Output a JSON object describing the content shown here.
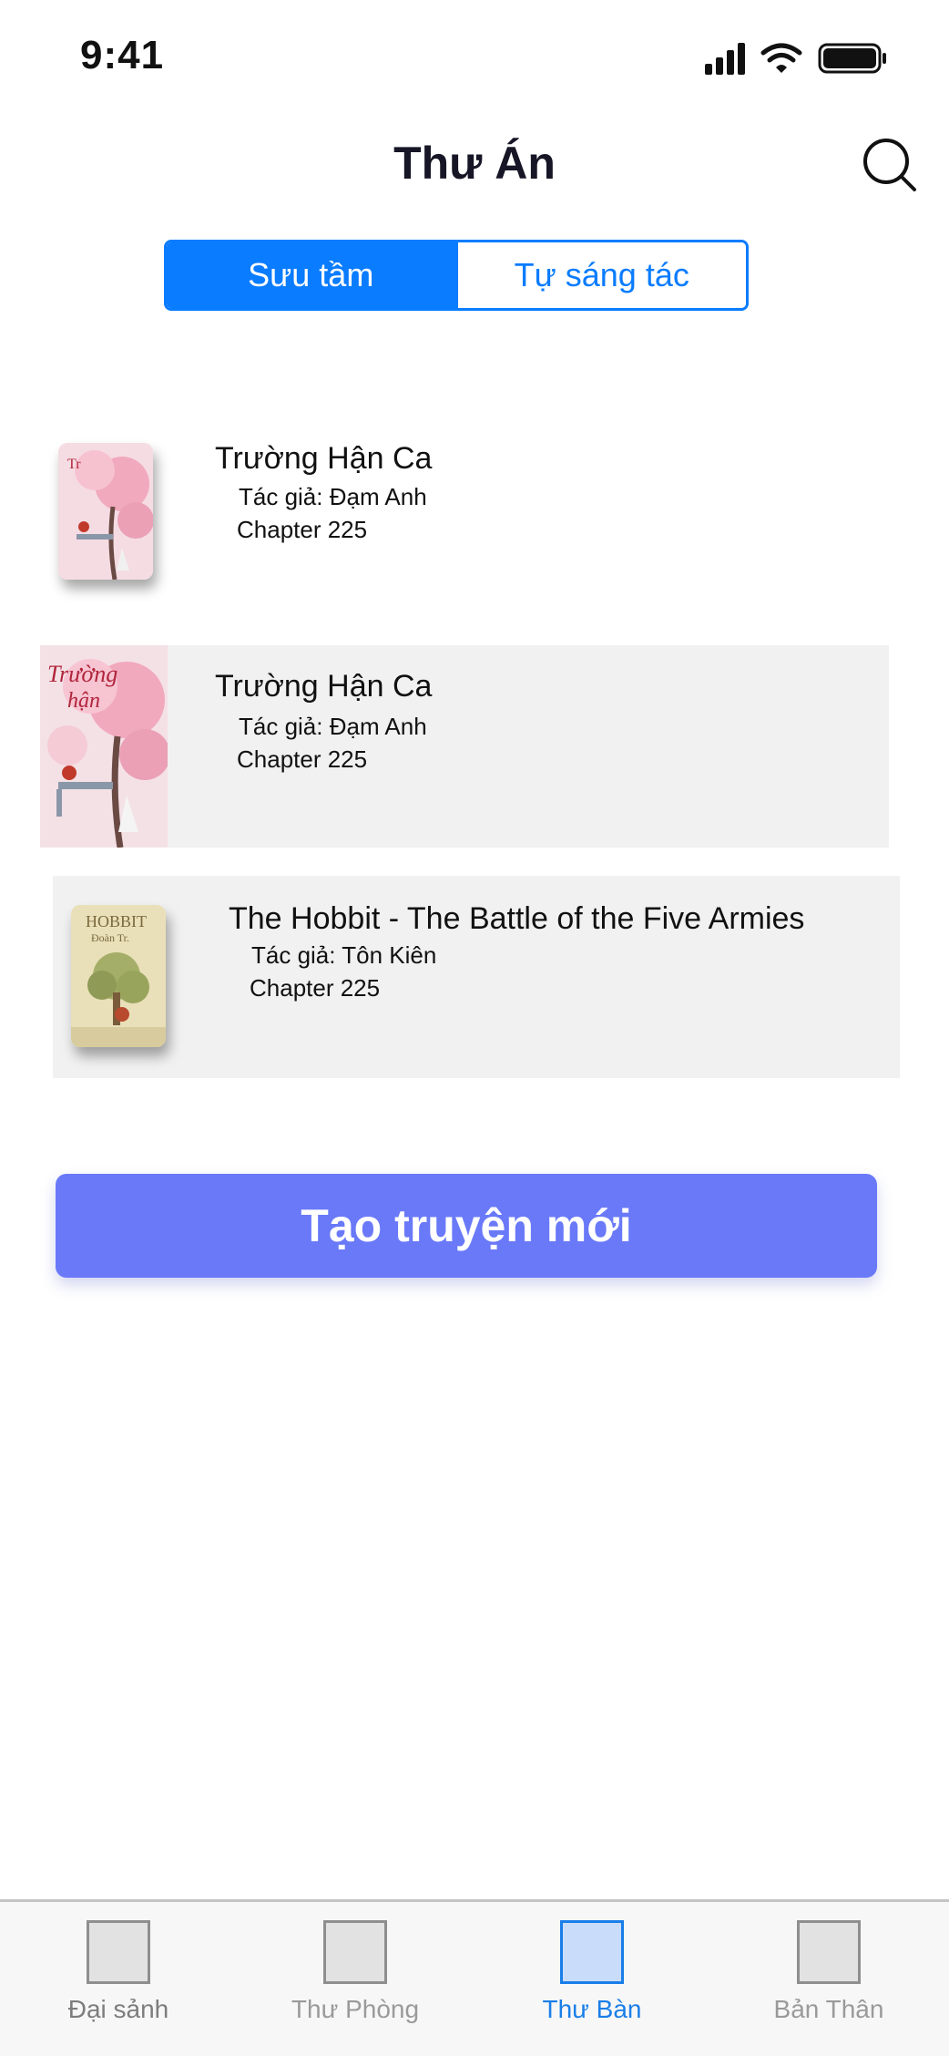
{
  "status_bar": {
    "time": "9:41"
  },
  "header": {
    "title": "Thư Án",
    "search_icon": "search-icon"
  },
  "segments": [
    {
      "label": "Sưu tầm",
      "active": true
    },
    {
      "label": "Tự sáng tác",
      "active": false
    }
  ],
  "books": [
    {
      "title": "Trường Hận Ca",
      "author": "Tác giả: Đạm Anh",
      "chapter": "Chapter 225"
    },
    {
      "title": "Trường Hận Ca",
      "author": "Tác giả: Đạm Anh",
      "chapter": "Chapter 225"
    },
    {
      "title": "The Hobbit - The Battle of the Five Armies",
      "author": "Tác giả: Tôn Kiên",
      "chapter": "Chapter 225"
    }
  ],
  "create_button": {
    "label": "Tạo truyện mới"
  },
  "tabbar": {
    "tabs": [
      {
        "label": "Đại sảnh",
        "active": false
      },
      {
        "label": "Thư Phòng",
        "active": false
      },
      {
        "label": "Thư Bàn",
        "active": true
      },
      {
        "label": "Bản Thân",
        "active": false
      }
    ]
  },
  "colors": {
    "accent": "#0a7cff",
    "create_button": "#6979f8",
    "row_background": "#f1f1f1",
    "tab_active": "#1a7ee8"
  }
}
